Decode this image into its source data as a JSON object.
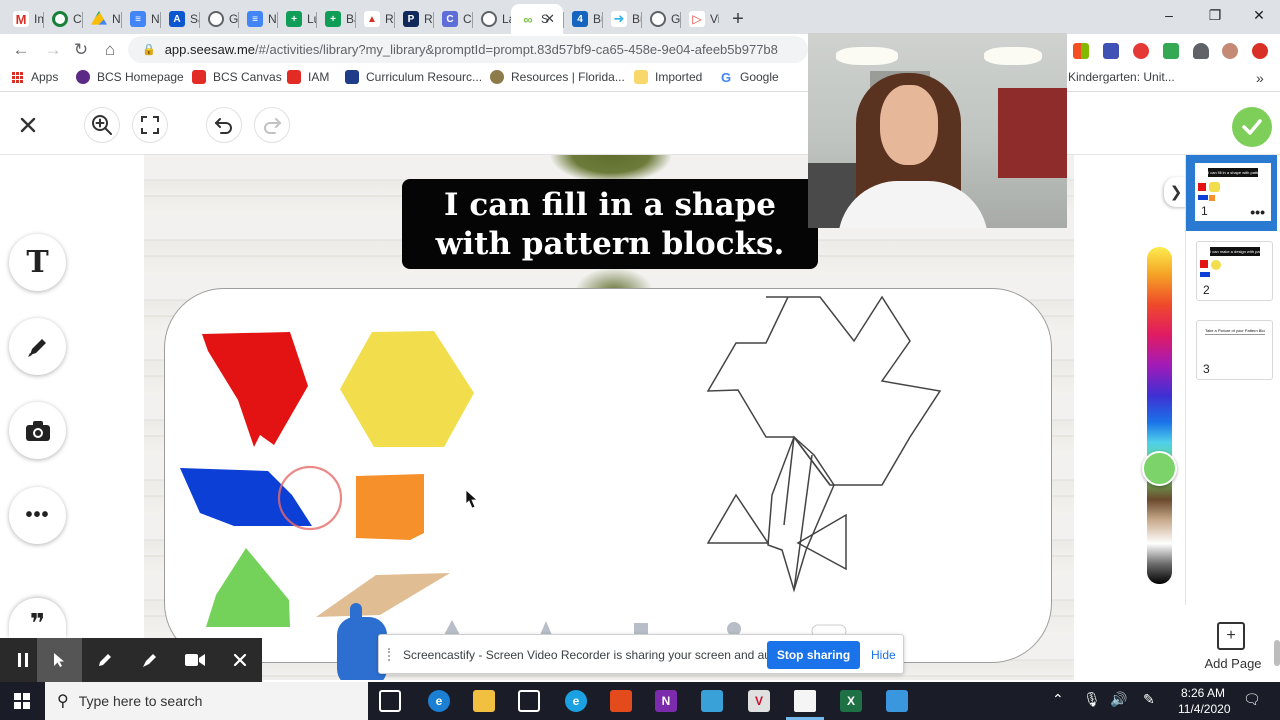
{
  "browser": {
    "tabs": [
      {
        "label": "Inbox",
        "icon": "gmail-icon"
      },
      {
        "label": "Class",
        "icon": "classroom-icon"
      },
      {
        "label": "Nov",
        "icon": "drive-icon"
      },
      {
        "label": "Nov",
        "icon": "docs-icon"
      },
      {
        "label": "Save",
        "icon": "app-icon"
      },
      {
        "label": "GK",
        "icon": "globe-icon"
      },
      {
        "label": "Nov",
        "icon": "docs-icon"
      },
      {
        "label": "Lunc",
        "icon": "sheets-icon"
      },
      {
        "label": "Barr",
        "icon": "sheets-icon"
      },
      {
        "label": "Rap",
        "icon": "rap-icon"
      },
      {
        "label": "Reco",
        "icon": "pr-icon"
      },
      {
        "label": "Clev",
        "icon": "clever-icon"
      },
      {
        "label": "Laur",
        "icon": "globe-icon"
      },
      {
        "label": "S",
        "icon": "seesaw-icon",
        "active": true
      },
      {
        "label": "Bun",
        "icon": "bun-icon"
      },
      {
        "label": "Buc",
        "icon": "buc-icon"
      },
      {
        "label": "GKN",
        "icon": "globe-icon"
      },
      {
        "label": "Vide",
        "icon": "video-icon"
      }
    ],
    "new_tab": "+",
    "window_controls": {
      "minimize": "–",
      "restore": "❐",
      "close": "✕"
    },
    "url_host": "app.seesaw.me",
    "url_path": "/#/activities/library?my_library&promptId=prompt.83d57bf9-ca65-458e-9e04-afeeb5b977b8"
  },
  "bookmarks": [
    {
      "label": "Apps",
      "icon": "apps-grid-icon"
    },
    {
      "label": "BCS Homepage",
      "icon": "bcs-icon"
    },
    {
      "label": "BCS Canvas",
      "icon": "canvas-icon"
    },
    {
      "label": "IAM",
      "icon": "iam-icon"
    },
    {
      "label": "Curriculum Resourc...",
      "icon": "curriculum-icon"
    },
    {
      "label": "Resources | Florida...",
      "icon": "florida-icon"
    },
    {
      "label": "Imported",
      "icon": "folder-icon"
    },
    {
      "label": "Google",
      "icon": "google-icon"
    },
    {
      "label": "Kindergarten: Unit...",
      "icon": "page-icon"
    }
  ],
  "bookmarks_more": "»",
  "seesaw": {
    "title_line1": "I can fill in a shape",
    "title_line2": "with pattern blocks.",
    "pages": [
      {
        "num": "1",
        "mini_title": "I can fill in a shape with pattern blocks",
        "more": "•••"
      },
      {
        "num": "2",
        "mini_title": "I can make a design with pattern blocks"
      },
      {
        "num": "3",
        "mini_title": "Take a Picture of your Pattern Block Puzzle"
      }
    ],
    "add_page_label": "Add Page",
    "selected_color": "#7bd36a",
    "tools": {
      "text": "T",
      "more": "•••",
      "quote": "❞"
    }
  },
  "screencastify": {
    "message": "Screencastify - Screen Video Recorder is sharing your screen and audio.",
    "stop_label": "Stop sharing",
    "hide_label": "Hide"
  },
  "taskbar": {
    "search_placeholder": "Type here to search",
    "time": "8:26 AM",
    "date": "11/4/2020"
  },
  "colors": {
    "red_block": "#e31313",
    "yellow_block": "#f2de4c",
    "blue_block": "#0c3fd6",
    "orange_block": "#f6902b",
    "green_block": "#74d25a",
    "tan_block": "#e1bd94",
    "seesaw_green": "#7dcf5a",
    "share_blue": "#1a73e8"
  }
}
